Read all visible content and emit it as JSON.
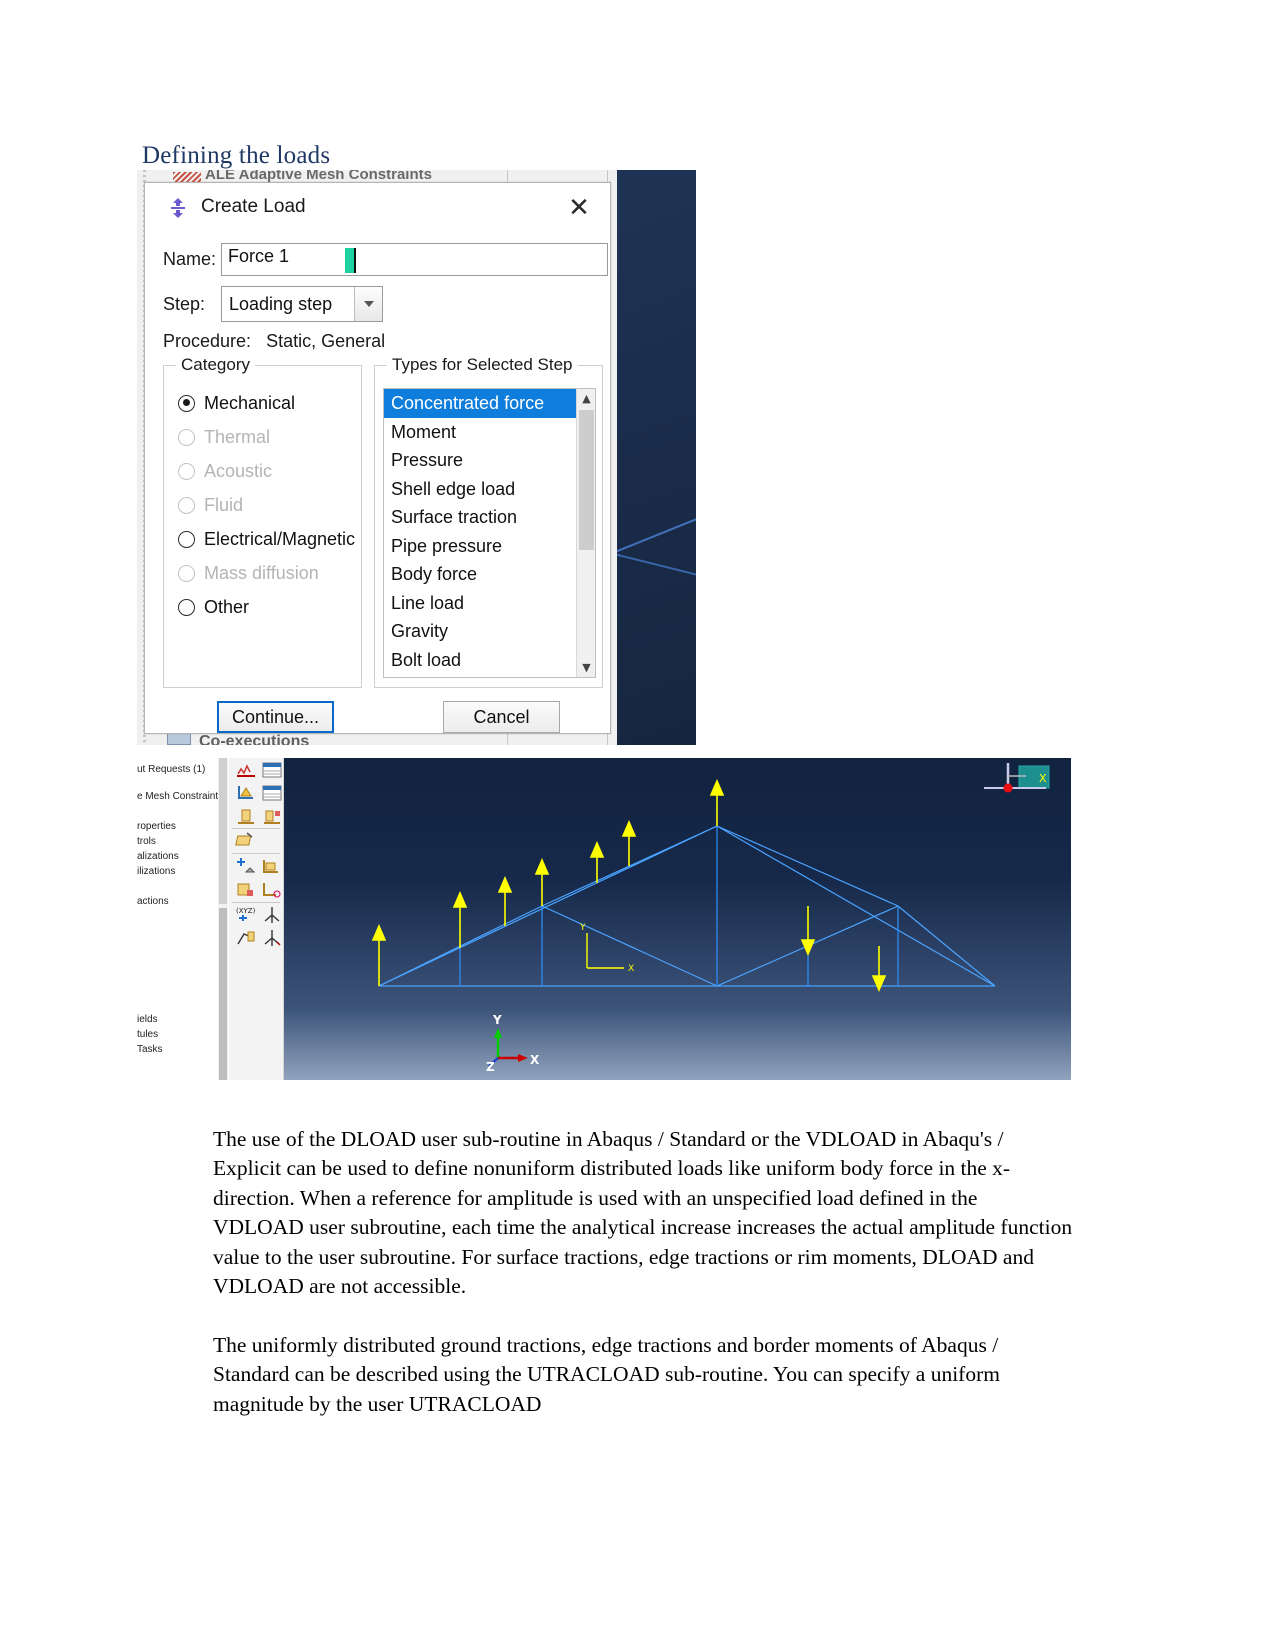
{
  "document": {
    "heading": "Defining the loads",
    "paragraphs": [
      "The use of the DLOAD user sub-routine in Abaqus / Standard or the VDLOAD in Abaqu's / Explicit can be used to define nonuniform distributed loads like uniform body force in the x-direction. When a reference for amplitude is used with an unspecified load defined in the VDLOAD user subroutine, each time the analytical increase increases the actual amplitude function value to the user subroutine. For surface tractions, edge tractions or rim moments, DLOAD and VDLOAD are not accessible.",
      "The uniformly distributed ground tractions, edge tractions and border moments of Abaqus / Standard can be described using the UTRACLOAD sub-routine. You can specify a uniform magnitude by the user UTRACLOAD"
    ]
  },
  "dialog": {
    "title": "Create Load",
    "icon": "abaqus-load-icon",
    "close_label": "✕",
    "name": {
      "label": "Name:",
      "value": "Force 1"
    },
    "step": {
      "label": "Step:",
      "value": "Loading step",
      "options": [
        "Loading step"
      ]
    },
    "procedure": {
      "label": "Procedure:",
      "value": "Static, General"
    },
    "category": {
      "title": "Category",
      "items": [
        {
          "label": "Mechanical",
          "selected": true,
          "enabled": true
        },
        {
          "label": "Thermal",
          "selected": false,
          "enabled": false
        },
        {
          "label": "Acoustic",
          "selected": false,
          "enabled": false
        },
        {
          "label": "Fluid",
          "selected": false,
          "enabled": false
        },
        {
          "label": "Electrical/Magnetic",
          "selected": false,
          "enabled": true
        },
        {
          "label": "Mass diffusion",
          "selected": false,
          "enabled": false
        },
        {
          "label": "Other",
          "selected": false,
          "enabled": true
        }
      ]
    },
    "types": {
      "title": "Types for Selected Step",
      "items": [
        {
          "label": "Concentrated force",
          "selected": true
        },
        {
          "label": "Moment",
          "selected": false
        },
        {
          "label": "Pressure",
          "selected": false
        },
        {
          "label": "Shell edge load",
          "selected": false
        },
        {
          "label": "Surface traction",
          "selected": false
        },
        {
          "label": "Pipe pressure",
          "selected": false
        },
        {
          "label": "Body force",
          "selected": false
        },
        {
          "label": "Line load",
          "selected": false
        },
        {
          "label": "Gravity",
          "selected": false
        },
        {
          "label": "Bolt load",
          "selected": false
        }
      ],
      "scroll_up": "▲",
      "scroll_down": "▼"
    },
    "buttons": {
      "continue": "Continue...",
      "cancel": "Cancel"
    },
    "background_window": {
      "top_label": "ALE Adaptive Mesh Constraints",
      "bottom_label": "Co-executions"
    }
  },
  "viewport": {
    "tree_items": [
      "ut Requests (1)",
      "e Mesh Constraints",
      "roperties",
      "trols",
      "alizations",
      "ilizations",
      "actions",
      "ields",
      "tules",
      "Tasks"
    ],
    "tree_counts": [
      "(1)"
    ],
    "triad": {
      "y_label": "Y",
      "x_label": "X",
      "z_label": "Z"
    },
    "local_axes": {
      "y_label": "Y",
      "x_label": "X"
    },
    "compass_label": "X",
    "colors": {
      "load_arrow": "#ffff00",
      "truss_line": "#4aa3ff",
      "background_top": "#12233f",
      "background_bottom": "#90a3bd",
      "triad_y": "#00cc00",
      "triad_x": "#cc0000",
      "triad_z": "#2244cc",
      "compass": "#1d8f8f"
    },
    "loads": [
      {
        "id": "load-1",
        "direction": "up"
      },
      {
        "id": "load-2",
        "direction": "up"
      },
      {
        "id": "load-3",
        "direction": "up"
      },
      {
        "id": "load-4",
        "direction": "up"
      },
      {
        "id": "load-5",
        "direction": "up"
      },
      {
        "id": "load-6",
        "direction": "up"
      },
      {
        "id": "load-7",
        "direction": "up"
      },
      {
        "id": "load-8",
        "direction": "down"
      },
      {
        "id": "load-9",
        "direction": "down"
      }
    ]
  }
}
